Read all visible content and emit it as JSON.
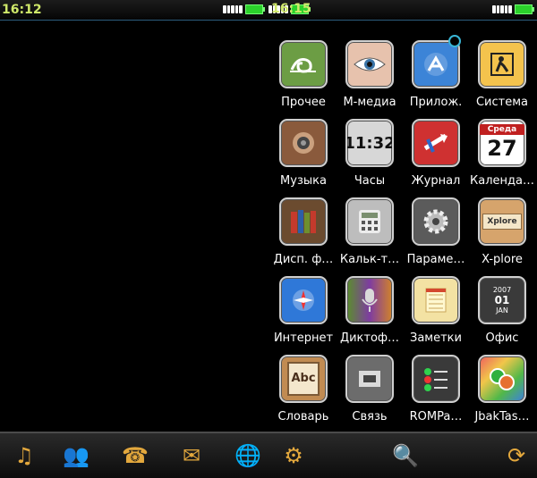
{
  "status": {
    "left_time": "16:12",
    "right_time": "16:15"
  },
  "apps": [
    {
      "label": "Прочее",
      "icon": "snail-icon",
      "color": "#5c8c3a"
    },
    {
      "label": "М-медиа",
      "icon": "eye-icon",
      "color": "#d9b49c"
    },
    {
      "label": "Прилож.",
      "icon": "app-store-icon",
      "color": "#3c84d7"
    },
    {
      "label": "Система",
      "icon": "worker-sign-icon",
      "color": "#f4c34d"
    },
    {
      "label": "Музыка",
      "icon": "speaker-icon",
      "color": "#8a5a3c"
    },
    {
      "label": "Часы",
      "icon": "flip-clock-icon",
      "color": "#d7d7d7"
    },
    {
      "label": "Журнал",
      "icon": "call-log-icon",
      "color": "#d33"
    },
    {
      "label": "Календа…",
      "icon": "calendar-icon",
      "color": "#fff"
    },
    {
      "label": "Дисп. ф…",
      "icon": "books-icon",
      "color": "#6b4b2f"
    },
    {
      "label": "Кальк-т…",
      "icon": "calculator-icon",
      "color": "#b4b4b4"
    },
    {
      "label": "Параме…",
      "icon": "gear-icon",
      "color": "#595959"
    },
    {
      "label": "X-plore",
      "icon": "file-box-icon",
      "color": "#d6a46c"
    },
    {
      "label": "Интернет",
      "icon": "compass-icon",
      "color": "#2f78d8"
    },
    {
      "label": "Диктоф…",
      "icon": "microphone-icon",
      "color": "#444"
    },
    {
      "label": "Заметки",
      "icon": "notepad-icon",
      "color": "#f3e2a3"
    },
    {
      "label": "Офис",
      "icon": "office-calendar-icon",
      "color": "#3a3a3a"
    },
    {
      "label": "Словарь",
      "icon": "dictionary-icon",
      "color": "#c18b52"
    },
    {
      "label": "Связь",
      "icon": "network-icon",
      "color": "#6c6c6c"
    },
    {
      "label": "ROMPa…",
      "icon": "switches-icon",
      "color": "#3a3a3a"
    },
    {
      "label": "JbakTas…",
      "icon": "gears-color-icon",
      "color": "#f06b5c"
    }
  ],
  "calendar": {
    "day": "Среда",
    "date": "27"
  },
  "clock": {
    "time": "11:32"
  },
  "dictionary": {
    "text": "Abc"
  },
  "xplore": {
    "text": "Xplore"
  },
  "office": {
    "year": "2007",
    "day": "01",
    "month": "JAN"
  },
  "dock": [
    {
      "icon": "music-note-icon"
    },
    {
      "icon": "contacts-icon"
    },
    {
      "icon": "phone-icon"
    },
    {
      "icon": "mail-icon"
    },
    {
      "icon": "globe-icon"
    },
    {
      "icon": "apps-icon"
    },
    {
      "icon": "search-icon"
    },
    {
      "icon": "refresh-icon"
    }
  ]
}
